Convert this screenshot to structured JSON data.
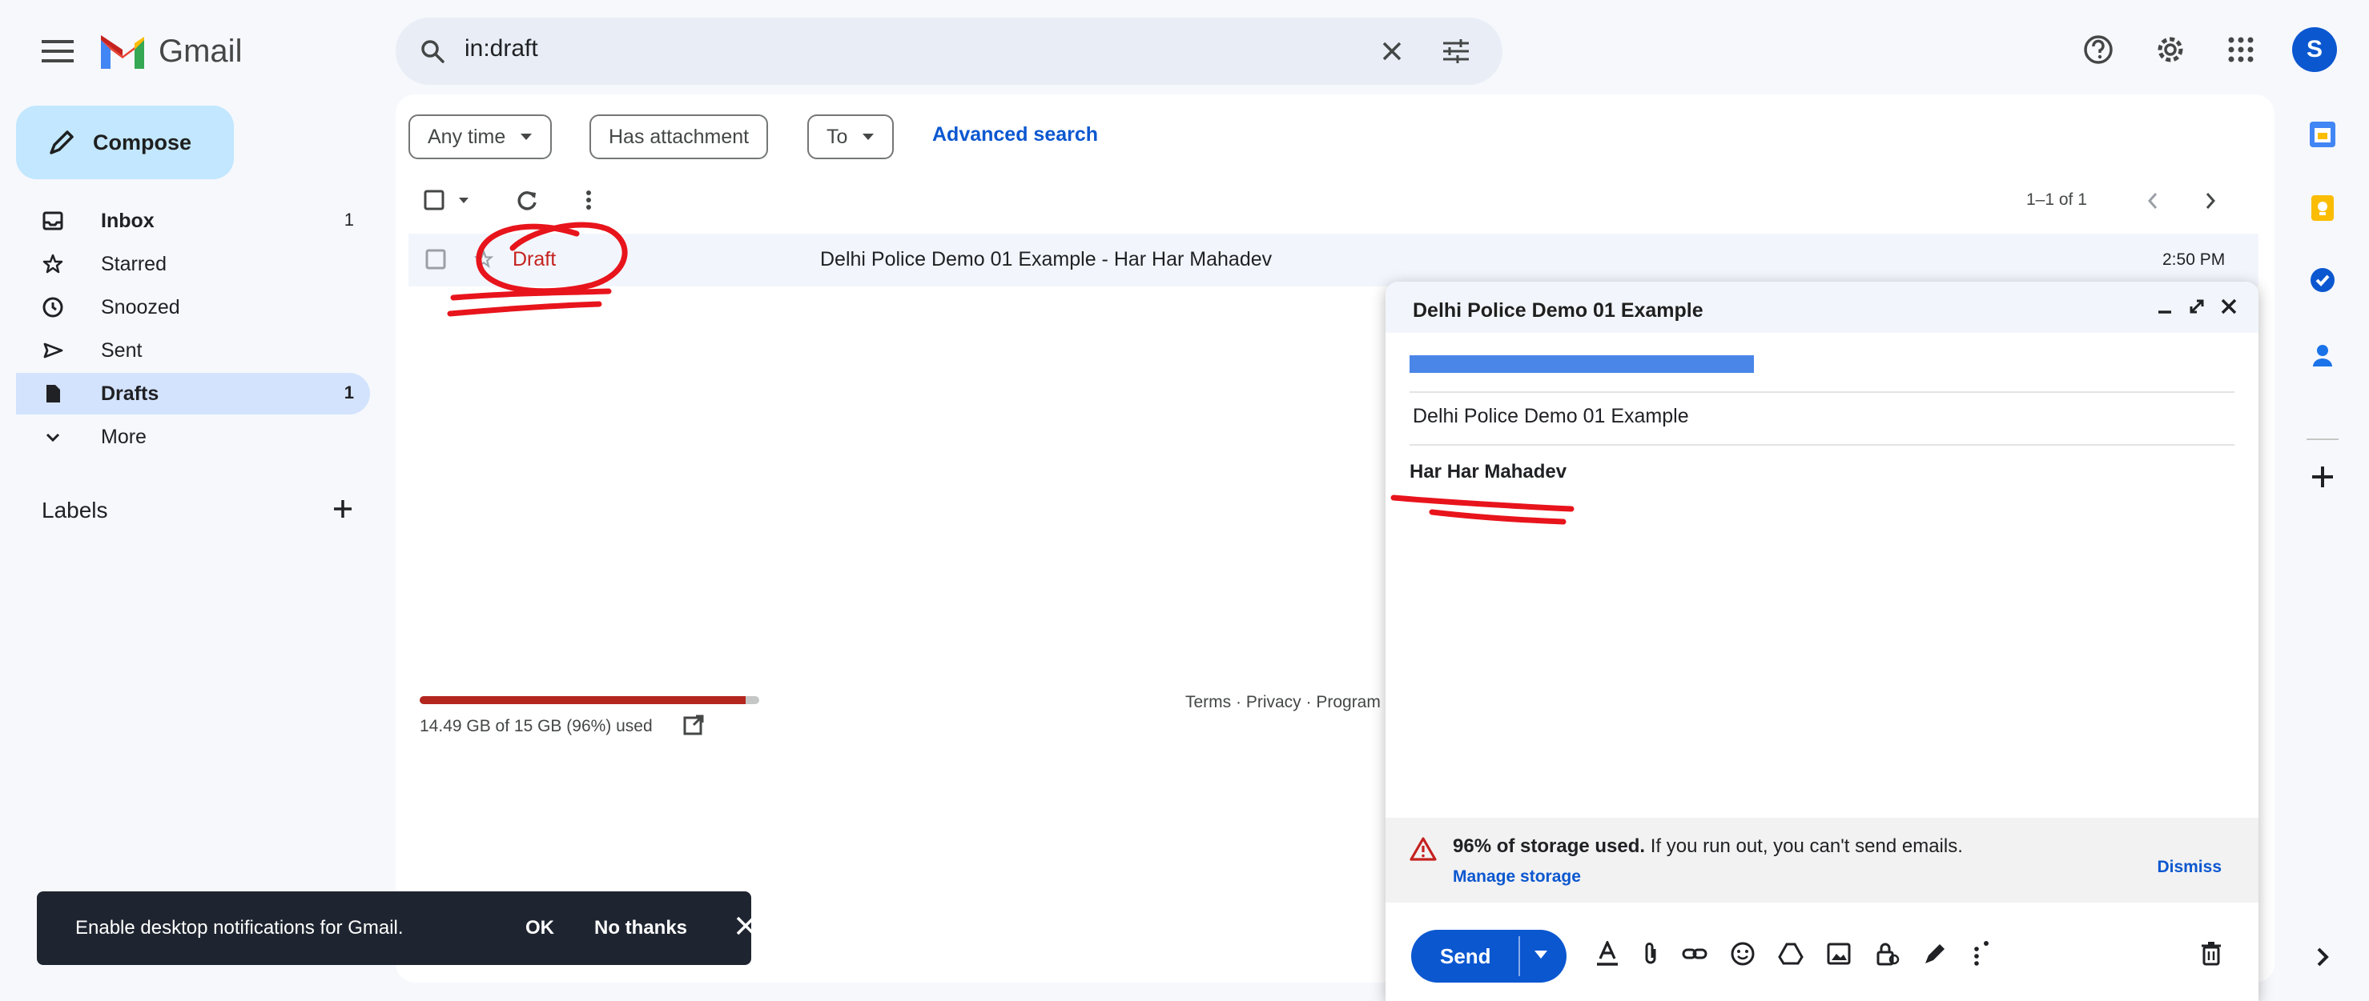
{
  "app": {
    "name": "Gmail"
  },
  "search": {
    "query": "in:draft"
  },
  "compose_button": {
    "label": "Compose"
  },
  "nav": {
    "items": [
      {
        "label": "Inbox",
        "count": "1",
        "icon": "inbox-icon"
      },
      {
        "label": "Starred",
        "count": "",
        "icon": "star-icon"
      },
      {
        "label": "Snoozed",
        "count": "",
        "icon": "clock-icon"
      },
      {
        "label": "Sent",
        "count": "",
        "icon": "send-icon"
      },
      {
        "label": "Drafts",
        "count": "1",
        "icon": "draft-icon"
      },
      {
        "label": "More",
        "count": "",
        "icon": "chevron-down-icon"
      }
    ],
    "labels_title": "Labels"
  },
  "filters": {
    "any_time": "Any time",
    "has_attachment": "Has attachment",
    "to": "To",
    "advanced_search": "Advanced search"
  },
  "list": {
    "pager": "1–1 of 1",
    "rows": [
      {
        "sender": "Draft",
        "subject": "Delhi Police Demo 01 Example - Har Har Mahadev",
        "time": "2:50 PM"
      }
    ]
  },
  "storage": {
    "text": "14.49 GB of 15 GB (96%) used",
    "fraction": 0.96
  },
  "footer": {
    "links": "Terms · Privacy · Program"
  },
  "compose_window": {
    "title": "Delhi Police Demo 01 Example",
    "subject": "Delhi Police Demo 01 Example",
    "body": "Har Har Mahadev",
    "warning_bold": "96% of storage used.",
    "warning_rest": " If you run out, you can't send emails.",
    "manage_storage": "Manage storage",
    "dismiss": "Dismiss",
    "send": "Send"
  },
  "snackbar": {
    "text": "Enable desktop notifications for Gmail.",
    "ok": "OK",
    "no_thanks": "No thanks"
  },
  "profile": {
    "initial": "S"
  },
  "colors": {
    "accent": "#0b57d0",
    "compose_bg": "#c2e7ff",
    "active_nav": "#d3e3fd",
    "draft_red": "#c5221f",
    "annotation_red": "#e8141c"
  }
}
